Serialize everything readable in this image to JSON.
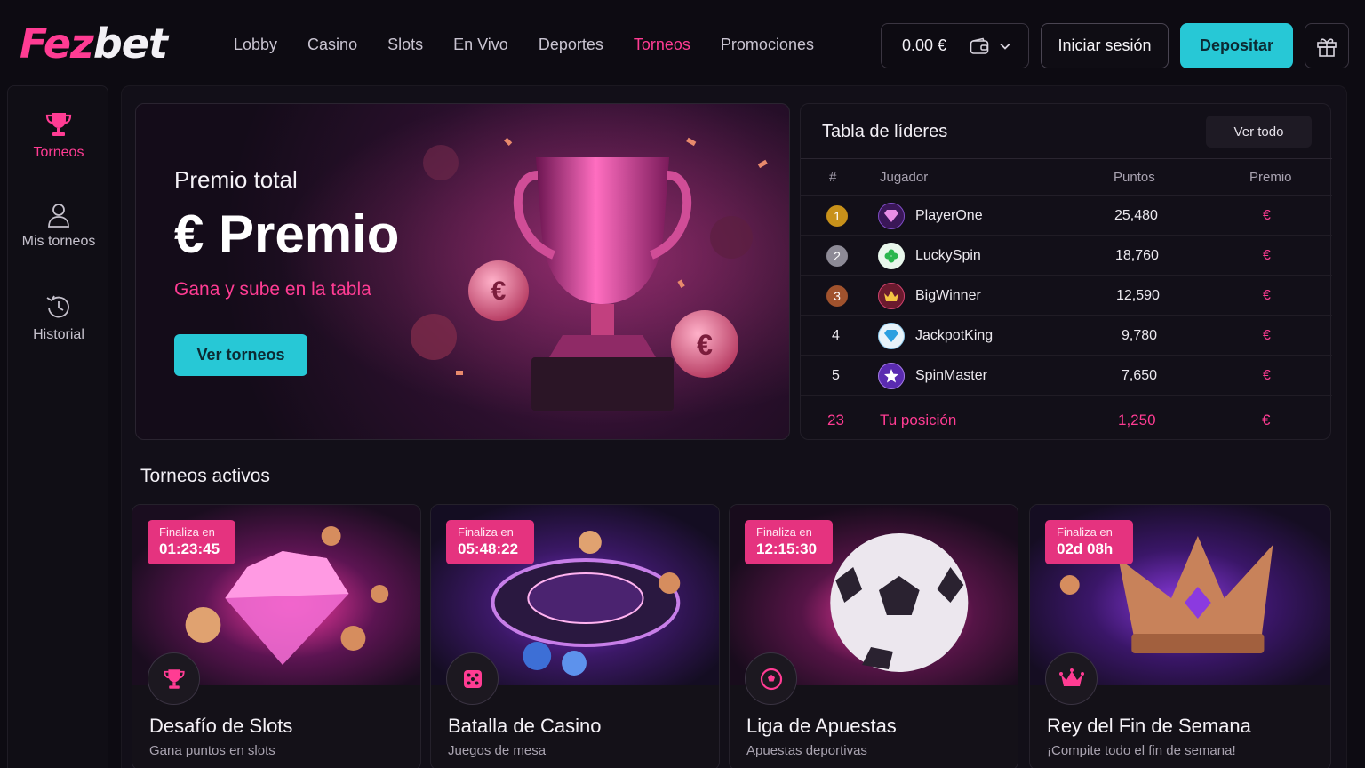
{
  "brand": {
    "part1": "Fez",
    "part2": "bet"
  },
  "nav": [
    "Lobby",
    "Casino",
    "Slots",
    "En Vivo",
    "Deportes",
    "Torneos",
    "Promociones"
  ],
  "nav_active": "Torneos",
  "header": {
    "balance": "0.00 €",
    "login": "Iniciar sesión",
    "deposit": "Depositar"
  },
  "sidebar": {
    "items": [
      {
        "label": "Torneos",
        "icon": "trophy-icon"
      },
      {
        "label": "Mis torneos",
        "icon": "user-icon"
      },
      {
        "label": "Historial",
        "icon": "history-icon"
      }
    ]
  },
  "hero": {
    "total_label": "Premio total",
    "prize": "€ Premio",
    "subtitle": "Gana y sube en la tabla",
    "cta": "Ver torneos"
  },
  "leaderboard": {
    "title": "Tabla de líderes",
    "view_all": "Ver todo",
    "columns": [
      "#",
      "Jugador",
      "Puntos",
      "Premio"
    ],
    "rows": [
      {
        "rank": "1",
        "player": "PlayerOne",
        "points": "25,480",
        "prize": "€",
        "avatar_icon": "diamond-icon"
      },
      {
        "rank": "2",
        "player": "LuckySpin",
        "points": "18,760",
        "prize": "€",
        "avatar_icon": "clover-icon"
      },
      {
        "rank": "3",
        "player": "BigWinner",
        "points": "12,590",
        "prize": "€",
        "avatar_icon": "crown-icon"
      },
      {
        "rank": "4",
        "player": "JackpotKing",
        "points": "9,780",
        "prize": "€",
        "avatar_icon": "diamond-icon"
      },
      {
        "rank": "5",
        "player": "SpinMaster",
        "points": "7,650",
        "prize": "€",
        "avatar_icon": "star-icon"
      }
    ],
    "me": {
      "rank": "23",
      "label": "Tu posición",
      "points": "1,250",
      "prize": "€"
    }
  },
  "active": {
    "title": "Torneos activos",
    "ends_label": "Finaliza en",
    "cards": [
      {
        "time": "01:23:45",
        "title": "Desafío de Slots",
        "sub": "Gana puntos en slots",
        "icon": "trophy-icon"
      },
      {
        "time": "05:48:22",
        "title": "Batalla de Casino",
        "sub": "Juegos de mesa",
        "icon": "dice-icon"
      },
      {
        "time": "12:15:30",
        "title": "Liga de Apuestas",
        "sub": "Apuestas deportivas",
        "icon": "soccer-ball-icon"
      },
      {
        "time": "02d 08h",
        "title": "Rey del Fin de Semana",
        "sub": "¡Compite todo el fin de semana!",
        "icon": "crown-icon"
      }
    ]
  },
  "colors": {
    "accent": "#ff3c93",
    "cta": "#27c8d6",
    "background": "#0d0b12",
    "gold": "#c8911a",
    "silver": "#8d8a96",
    "bronze": "#a0522d"
  }
}
